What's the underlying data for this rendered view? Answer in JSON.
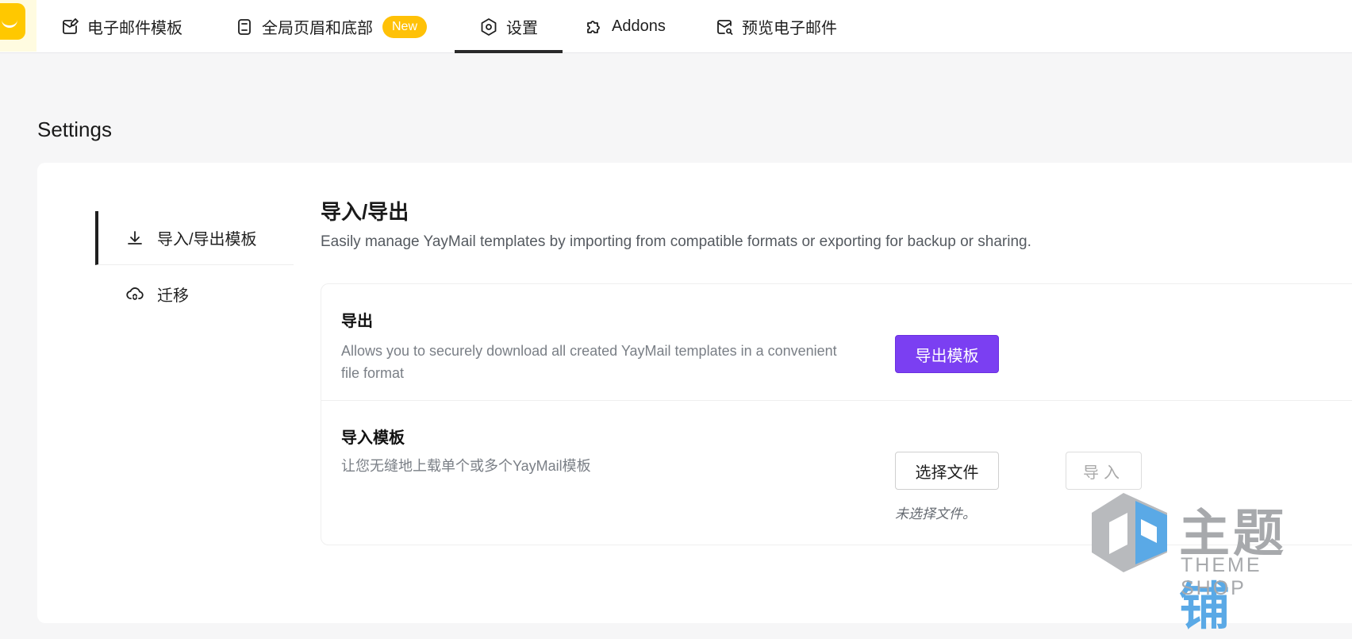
{
  "nav": {
    "items": [
      {
        "label": "电子邮件模板",
        "icon": "mail-edit-icon"
      },
      {
        "label": "全局页眉和底部",
        "icon": "layout-icon",
        "badge": "New"
      },
      {
        "label": "设置",
        "icon": "settings-hexagon-icon",
        "active": true
      },
      {
        "label": "Addons",
        "icon": "puzzle-icon"
      },
      {
        "label": "预览电子邮件",
        "icon": "mail-search-icon"
      }
    ]
  },
  "page": {
    "title": "Settings"
  },
  "sidebar": {
    "items": [
      {
        "label": "导入/导出模板",
        "icon": "download-icon",
        "active": true
      },
      {
        "label": "迁移",
        "icon": "cloud-sync-icon"
      }
    ]
  },
  "section": {
    "title": "导入/导出",
    "description": "Easily manage YayMail templates by importing from compatible formats or exporting for backup or sharing."
  },
  "export": {
    "title": "导出",
    "description": "Allows you to securely download all created YayMail templates in a convenient file format",
    "button": "导出模板"
  },
  "import": {
    "title": "导入模板",
    "description": "让您无缝地上载单个或多个YayMail模板",
    "choose_button": "选择文件",
    "import_button": "导入",
    "no_file": "未选择文件。"
  },
  "watermark": {
    "title_gray": "主题",
    "title_blue": "铺",
    "subtitle": "THEME SHOP"
  },
  "colors": {
    "accent": "#7b3ff2",
    "badge": "#ffc107",
    "logo": "#ffc800"
  }
}
